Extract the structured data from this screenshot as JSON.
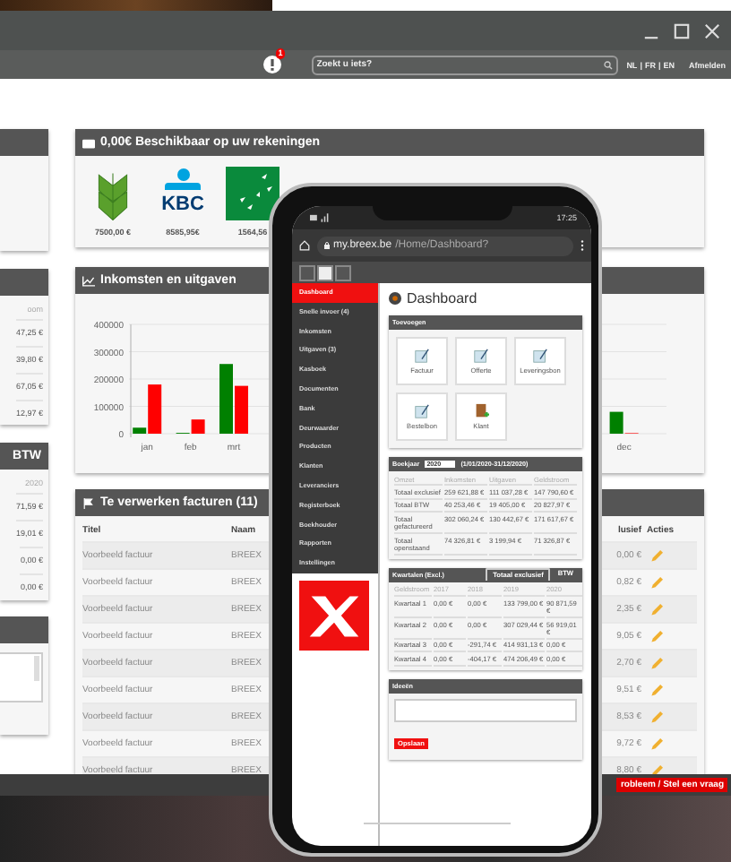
{
  "topbar": {
    "notification_count": "1",
    "search": {
      "placeholder": "Zoekt u iets?"
    },
    "languages": [
      "NL",
      "FR",
      "EN"
    ],
    "language_separator": "|",
    "logout": "Afmelden"
  },
  "left_panels": [
    {
      "kind": "blank"
    },
    {
      "kind": "table",
      "column": "oom",
      "values": [
        "47,25 €",
        "39,80 €",
        "67,05 €",
        "12,97 €"
      ]
    },
    {
      "kind": "table",
      "header": "BTW",
      "column": "2020",
      "values": [
        "71,59 €",
        "19,01 €",
        "0,00 €",
        "0,00 €"
      ]
    },
    {
      "kind": "textarea"
    }
  ],
  "accounts_panel": {
    "title": "0,00€ Beschikbaar op uw rekeningen",
    "banks": [
      {
        "kind": "wheat",
        "amount": "7500,00 €"
      },
      {
        "kind": "kbc",
        "logo_text": "KBC",
        "amount": "8585,95€"
      },
      {
        "kind": "birds",
        "amount": "1564,56"
      }
    ]
  },
  "income_panel": {
    "title": "Inkomsten en uitgaven",
    "chart_data": {
      "type": "bar",
      "categories": [
        "jan",
        "feb",
        "mrt",
        null,
        null,
        null,
        null,
        null,
        null,
        null,
        null,
        "dec"
      ],
      "series": [
        {
          "color": "#008000",
          "values": [
            22000,
            3000,
            255000,
            null,
            null,
            null,
            null,
            null,
            null,
            null,
            null,
            80000
          ]
        },
        {
          "color": "#ff0000",
          "values": [
            180000,
            52000,
            175000,
            null,
            null,
            null,
            null,
            null,
            null,
            null,
            null,
            2000
          ]
        }
      ],
      "ylim": [
        0,
        400000
      ],
      "yticks": [
        0,
        100000,
        200000,
        300000,
        400000
      ],
      "grid": true
    }
  },
  "invoices_panel": {
    "title": "Te verwerken facturen (11)",
    "columns": [
      "Titel",
      "Naam",
      "lusief",
      "Acties"
    ],
    "rows": [
      {
        "title": "Voorbeeld factuur",
        "name": "BREEX",
        "amount": "0,00 €"
      },
      {
        "title": "Voorbeeld factuur",
        "name": "BREEX",
        "amount": "0,82 €"
      },
      {
        "title": "Voorbeeld factuur",
        "name": "BREEX",
        "amount": "2,35 €"
      },
      {
        "title": "Voorbeeld factuur",
        "name": "BREEX",
        "amount": "9,05 €"
      },
      {
        "title": "Voorbeeld factuur",
        "name": "BREEX",
        "amount": "2,70 €"
      },
      {
        "title": "Voorbeeld factuur",
        "name": "BREEX",
        "amount": "9,51 €"
      },
      {
        "title": "Voorbeeld factuur",
        "name": "BREEX",
        "amount": "8,53 €"
      },
      {
        "title": "Voorbeeld factuur",
        "name": "BREEX",
        "amount": "9,72 €"
      },
      {
        "title": "Voorbeeld factuur",
        "name": "BREEX",
        "amount": "8,80 €"
      }
    ]
  },
  "footer": {
    "text": "robleem / Stel een vraag"
  },
  "phone": {
    "time": "17:25",
    "url_host": "my.breex.be",
    "url_path": "/Home/Dashboard?",
    "sidebar": [
      {
        "label": "Dashboard",
        "selected": true
      },
      {
        "label": "Snelle invoer (4)",
        "selected": false
      },
      {
        "label": "Inkomsten",
        "selected": false
      },
      {
        "label": "Uitgaven (3)",
        "selected": false
      },
      {
        "label": "Kasboek",
        "selected": false
      },
      {
        "label": "Documenten",
        "selected": false
      },
      {
        "label": "Bank",
        "selected": false
      },
      {
        "label": "Deurwaarder",
        "selected": false
      },
      {
        "label": "Producten",
        "selected": false
      },
      {
        "label": "Klanten",
        "selected": false
      },
      {
        "label": "Leveranciers",
        "selected": false
      },
      {
        "label": "Registerboek",
        "selected": false
      },
      {
        "label": "Boekhouder",
        "selected": false
      },
      {
        "label": "Rapporten",
        "selected": false
      },
      {
        "label": "Instellingen",
        "selected": false
      }
    ],
    "page_title": "Dashboard",
    "add_panel": {
      "title": "Toevoegen",
      "tiles": [
        {
          "kind": "document",
          "label": "Factuur"
        },
        {
          "kind": "document",
          "label": "Offerte"
        },
        {
          "kind": "document",
          "label": "Leveringsbon"
        },
        {
          "kind": "document",
          "label": "Bestelbon"
        },
        {
          "kind": "contact-book",
          "label": "Klant"
        }
      ]
    },
    "year_panel": {
      "title": "Boekjaar",
      "year": "2020",
      "range": "(1/01/2020-31/12/2020)",
      "columns": [
        "Omzet",
        "Inkomsten",
        "Uitgaven",
        "Geldstroom"
      ],
      "rows": [
        {
          "label": "Totaal exclusief",
          "values": [
            "259 621,88 €",
            "111 037,28 €",
            "147 790,60 €"
          ]
        },
        {
          "label": "Totaal BTW",
          "values": [
            "40 253,46 €",
            "19 405,00 €",
            "20 827,97 €"
          ]
        },
        {
          "label": "Totaal gefactureerd",
          "values": [
            "302 060,24 €",
            "130 442,67 €",
            "171 617,67 €"
          ]
        },
        {
          "label": "Totaal openstaand",
          "values": [
            "74 326,81 €",
            "3 199,94 €",
            "71 326,87 €"
          ]
        }
      ]
    },
    "quarter_panel": {
      "title": "Kwartalen (Excl.)",
      "tabs": [
        {
          "label": "Totaal exclusief",
          "selected": true
        },
        {
          "label": "BTW",
          "selected": false
        }
      ],
      "columns": [
        "Geldstroom",
        "2017",
        "2018",
        "2019",
        "2020"
      ],
      "rows": [
        {
          "label": "Kwartaal 1",
          "values": [
            "0,00 €",
            "0,00 €",
            "133 799,00 €",
            "90 871,59 €"
          ]
        },
        {
          "label": "Kwartaal 2",
          "values": [
            "0,00 €",
            "0,00 €",
            "307 029,44 €",
            "56 919,01 €"
          ]
        },
        {
          "label": "Kwartaal 3",
          "values": [
            "0,00 €",
            "-291,74 €",
            "414 931,13 €",
            "0,00 €"
          ]
        },
        {
          "label": "Kwartaal 4",
          "values": [
            "0,00 €",
            "-404,17 €",
            "474 206,49 €",
            "0,00 €"
          ]
        }
      ]
    },
    "ideas_panel": {
      "title": "Ideeën",
      "button": "Opslaan"
    }
  }
}
